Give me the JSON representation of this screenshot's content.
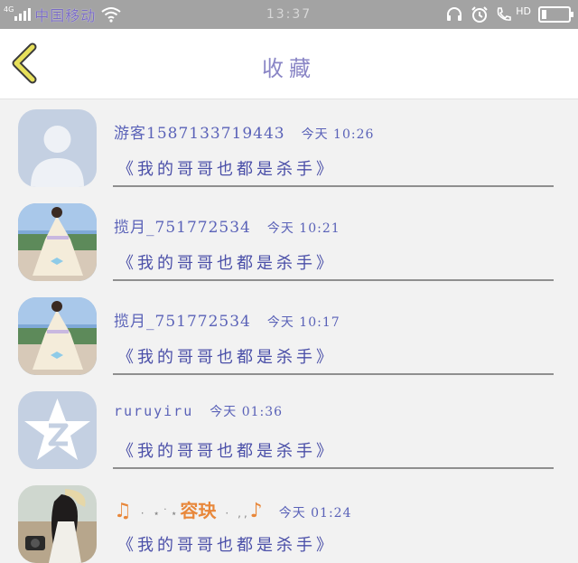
{
  "status_bar": {
    "network": "4G",
    "carrier": "中国移动",
    "time": "13:37",
    "hd": "HD",
    "battery_level": 0.18,
    "icons": [
      "signal-icon",
      "wifi-icon",
      "headset-icon",
      "alarm-icon",
      "call-icon",
      "battery-icon"
    ]
  },
  "header": {
    "title": "收藏",
    "back_icon": "back-chevron-icon",
    "accent": "#e7e05a"
  },
  "items": [
    {
      "username": "游客1587133719443",
      "time": "今天 10:26",
      "content": "《我的哥哥也都是杀手》",
      "avatar": "default-person"
    },
    {
      "username": "揽月_751772534",
      "time": "今天 10:21",
      "content": "《我的哥哥也都是杀手》",
      "avatar": "dress-photo"
    },
    {
      "username": "揽月_751772534",
      "time": "今天 10:17",
      "content": "《我的哥哥也都是杀手》",
      "avatar": "dress-photo"
    },
    {
      "username": "ruruyiru",
      "time": "今天 01:36",
      "content": "《我的哥哥也都是杀手》",
      "avatar": "qq-logo"
    },
    {
      "username_note_left": "♫",
      "username_dots_left": "· ⋆˙⋆",
      "username_core": "容玦",
      "username_dots_right": "· ‚‚",
      "username_note_right": "♪",
      "time": "今天 01:24",
      "content": "《我的哥哥也都是杀手》",
      "avatar": "girl-photo"
    }
  ]
}
